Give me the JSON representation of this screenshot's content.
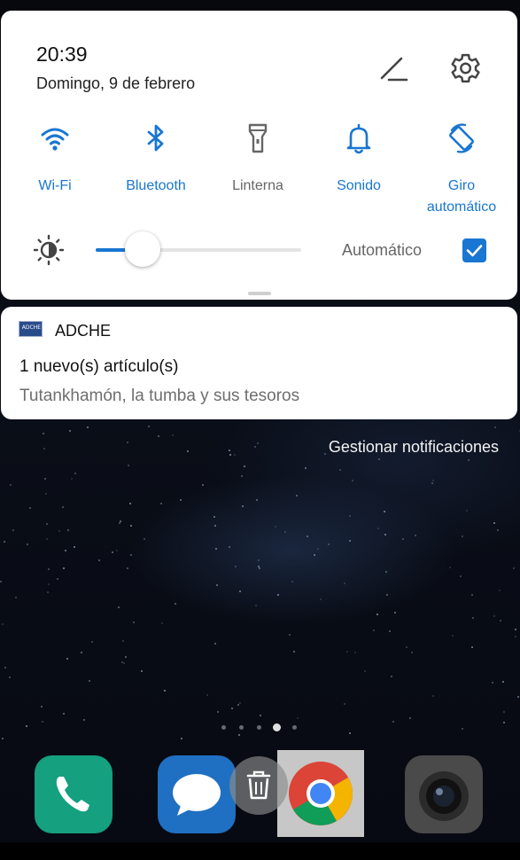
{
  "quick_settings": {
    "time": "20:39",
    "date": "Domingo, 9 de febrero",
    "tiles": [
      {
        "label": "Wi-Fi",
        "icon": "wifi-icon",
        "active": true
      },
      {
        "label": "Bluetooth",
        "icon": "bluetooth-icon",
        "active": true
      },
      {
        "label": "Linterna",
        "icon": "flashlight-icon",
        "active": false
      },
      {
        "label": "Sonido",
        "icon": "bell-icon",
        "active": true
      },
      {
        "label": "Giro\nautomático",
        "icon": "auto-rotate-icon",
        "active": true
      }
    ],
    "brightness": {
      "level": 0.23,
      "auto_label": "Automático",
      "auto_checked": true
    }
  },
  "notification": {
    "app_name": "ADCHE",
    "app_icon_text": "ADCHE",
    "title": "1 nuevo(s) artículo(s)",
    "body": "Tutankhamón, la tumba y sus tesoros"
  },
  "manage_notifications": "Gestionar notificaciones",
  "dock": {
    "apps": [
      "phone-icon",
      "messages-icon",
      "chrome-icon",
      "camera-icon"
    ],
    "page_count": 5,
    "active_page": 3
  },
  "colors": {
    "accent": "#1976d2",
    "inactive": "#666666",
    "panel": "#ffffff"
  }
}
